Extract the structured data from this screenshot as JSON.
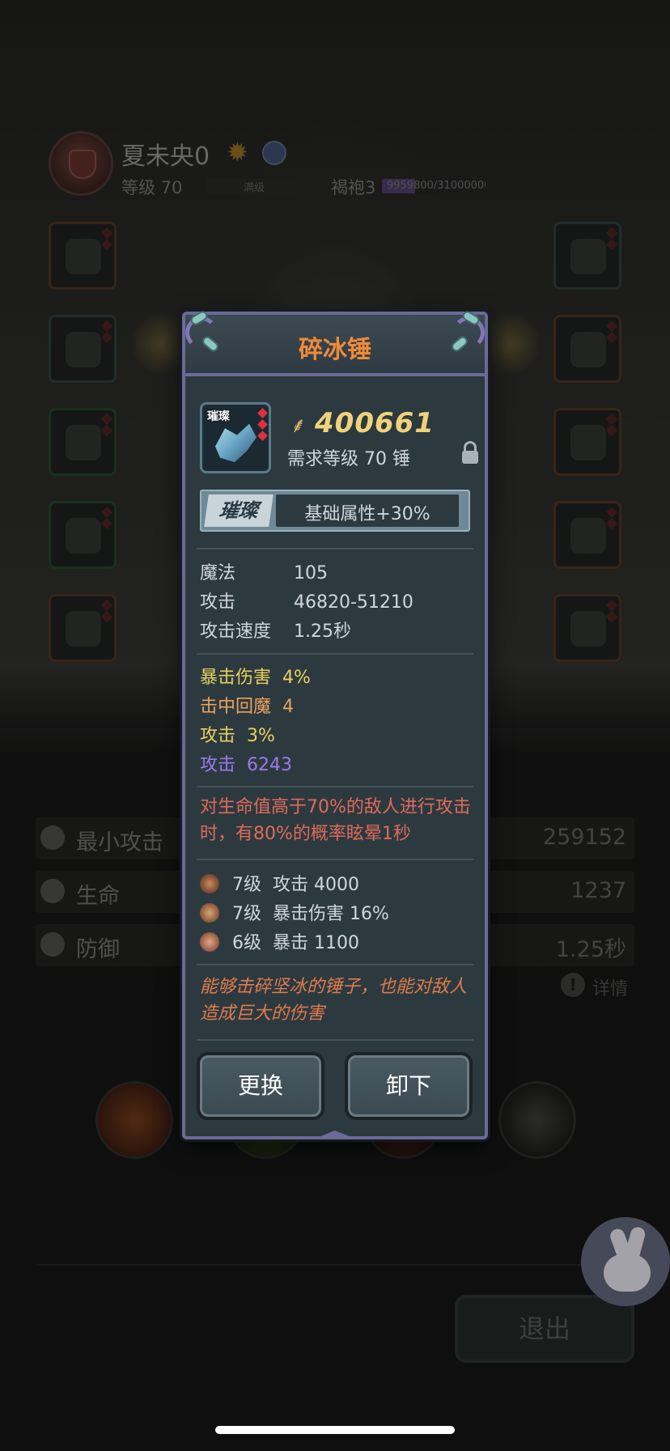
{
  "character": {
    "name": "夏未央0",
    "level": "等级 70",
    "max_label": "满级",
    "robe": "褐袍3",
    "exp": "9959800/31000000",
    "exp_progress": 0.321
  },
  "popup": {
    "title": "碎冰锤",
    "item_tag": "璀璨",
    "price": "400661",
    "requirement": "需求等级 70   锤",
    "bonus_badge": "璀璨",
    "bonus_text": "基础属性+30%",
    "base_stats": [
      {
        "label": "魔法",
        "value": "105"
      },
      {
        "label": "攻击",
        "value": "46820-51210"
      },
      {
        "label": "攻击速度",
        "value": "1.25秒"
      }
    ],
    "extra_stats": [
      {
        "label": "暴击伤害",
        "value": "4%",
        "color": "#e8d05c"
      },
      {
        "label": "击中回魔",
        "value": "4",
        "color": "#eea25a"
      },
      {
        "label": "攻击",
        "value": "3%",
        "color": "#e8d05c"
      },
      {
        "label": "攻击",
        "value": "6243",
        "color": "#9a7aec"
      }
    ],
    "special": "对生命值高于70%的敌人进行攻击时，有80%的概率眩晕1秒",
    "gems": [
      {
        "level": "7级",
        "effect": "攻击 4000",
        "icon": "beast-gem-icon"
      },
      {
        "level": "7级",
        "effect": "暴击伤害 16%",
        "icon": "claw-gem-icon"
      },
      {
        "level": "6级",
        "effect": "暴击 1100",
        "icon": "skull-gem-icon"
      }
    ],
    "flavor": "能够击碎坚冰的锤子，也能对敌人造成巨大的伤害",
    "replace_button": "更换",
    "unequip_button": "卸下"
  },
  "background_stats": [
    {
      "label": "最小攻击",
      "value": "259152"
    },
    {
      "label": "生命",
      "value": "1237"
    },
    {
      "label": "防御",
      "value": "1.25秒"
    }
  ],
  "details_link": "详情",
  "exit_button": "退出",
  "colors": {
    "popup_border": "#6c6a96",
    "title": "#f08a3a",
    "price": "#f1d27a",
    "special": "#e06a58"
  }
}
